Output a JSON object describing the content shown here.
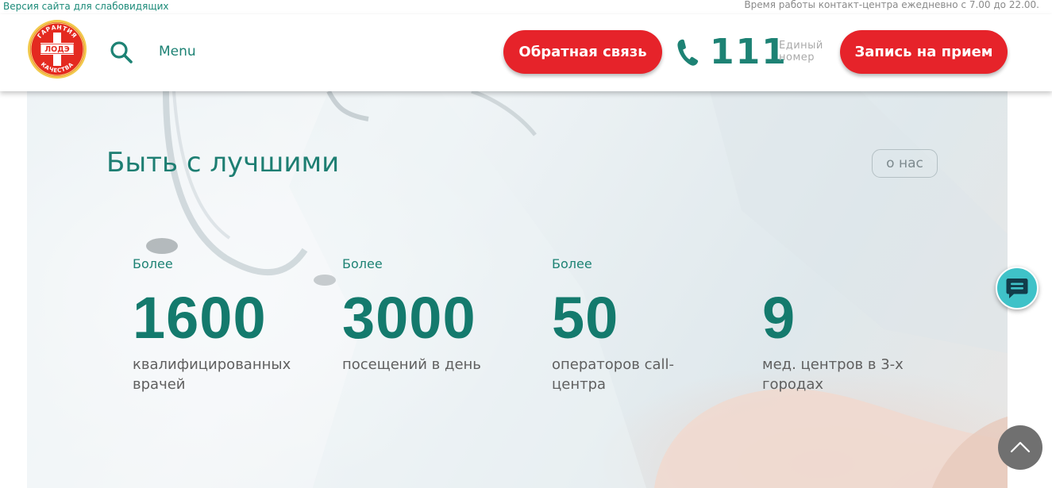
{
  "topbar": {
    "accessibility_link": "Версия сайта для слабовидящих",
    "work_hours": "Время работы контакт-центра ежедневно с 7.00 до 22.00."
  },
  "header": {
    "logo": {
      "text_top": "ГАРАНТИЯ",
      "text_center": "ЛОДЭ",
      "text_bottom": "КАЧЕСТВА"
    },
    "search_icon": "search-icon",
    "menu_label": "Menu",
    "feedback_button": "Обратная связь",
    "phone": {
      "icon": "phone-icon",
      "number": "111",
      "caption_line1": "Единый",
      "caption_line2": "номер"
    },
    "appointment_button": "Запись на прием"
  },
  "hero": {
    "title": "Быть с лучшими",
    "about_button": "о нас",
    "stats": [
      {
        "prefix": "Более",
        "value": "1600",
        "label_line1": "квалифицированных",
        "label_line2": "врачей"
      },
      {
        "prefix": "Более",
        "value": "3000",
        "label_line1": "посещений в день",
        "label_line2": ""
      },
      {
        "prefix": "Более",
        "value": "50",
        "label_line1": "операторов call-",
        "label_line2": "центра"
      },
      {
        "prefix": "",
        "value": "9",
        "label_line1": "мед. центров в 3-х",
        "label_line2": "городах"
      }
    ]
  },
  "widgets": {
    "chat_icon": "chat-icon",
    "scroll_top_icon": "chevron-up-icon"
  },
  "colors": {
    "brand_green": "#1d8274",
    "stat_green": "#147a6d",
    "accent_red": "#e6232a",
    "chat_teal": "#3fc2c8"
  }
}
